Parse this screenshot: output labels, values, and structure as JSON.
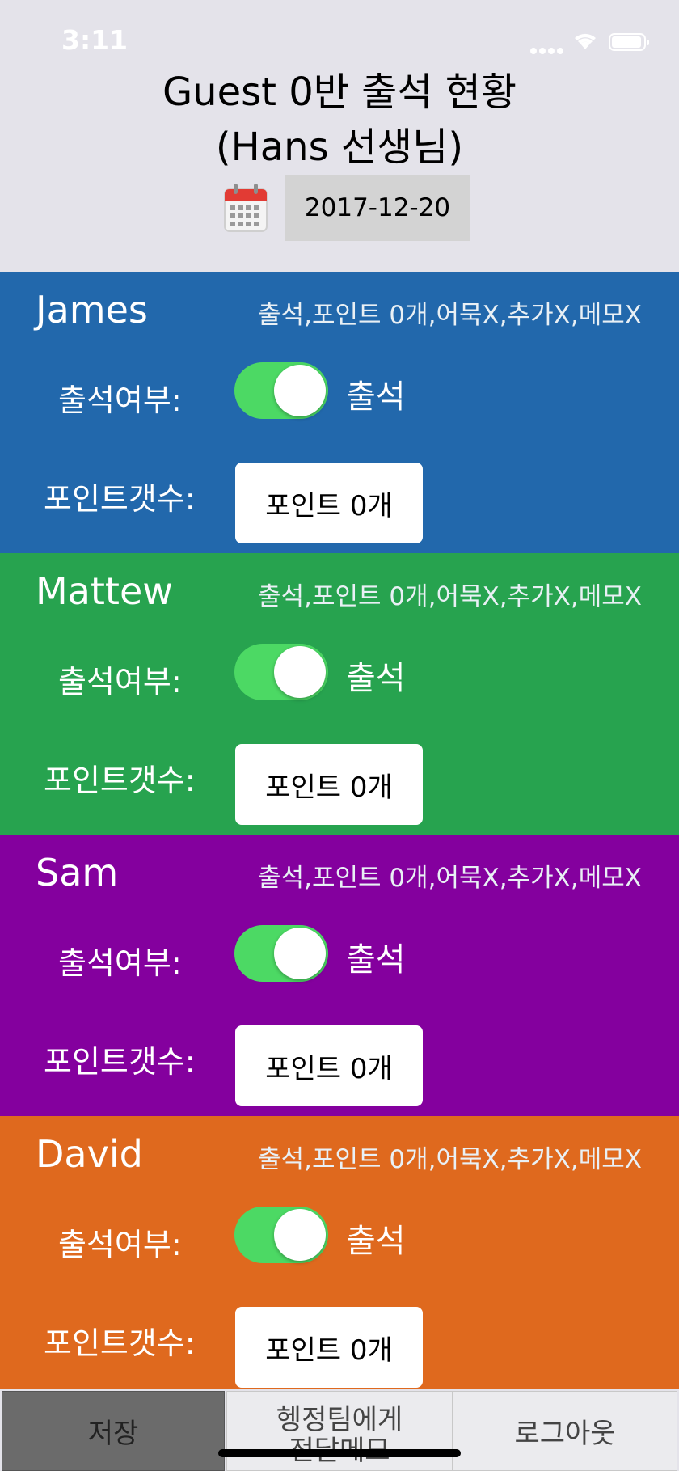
{
  "status_bar": {
    "time": "3:11"
  },
  "header": {
    "title_line1": "Guest  0반 출석 현황",
    "title_line2": "(Hans 선생님)",
    "date": "2017-12-20",
    "calendar_icon": "calendar-icon"
  },
  "labels": {
    "attendance": "출석여부:",
    "points": "포인트갯수:"
  },
  "students": [
    {
      "name": "James",
      "summary": "출석,포인트 0개,어묵X,추가X,메모X",
      "status": "출석",
      "present": true,
      "points_label": "포인트 0개",
      "color": "#2268ac"
    },
    {
      "name": "Mattew",
      "summary": "출석,포인트 0개,어묵X,추가X,메모X",
      "status": "출석",
      "present": true,
      "points_label": "포인트 0개",
      "color": "#27a34f"
    },
    {
      "name": "Sam",
      "summary": "출석,포인트 0개,어묵X,추가X,메모X",
      "status": "출석",
      "present": true,
      "points_label": "포인트 0개",
      "color": "#84009e"
    },
    {
      "name": "David",
      "summary": "출석,포인트 0개,어묵X,추가X,메모X",
      "status": "출석",
      "present": true,
      "points_label": "포인트 0개",
      "color": "#df691e"
    }
  ],
  "tabs": {
    "save": "저장",
    "memo_line1": "헹정팀에게",
    "memo_line2": "전달메모",
    "logout": "로그아웃"
  }
}
